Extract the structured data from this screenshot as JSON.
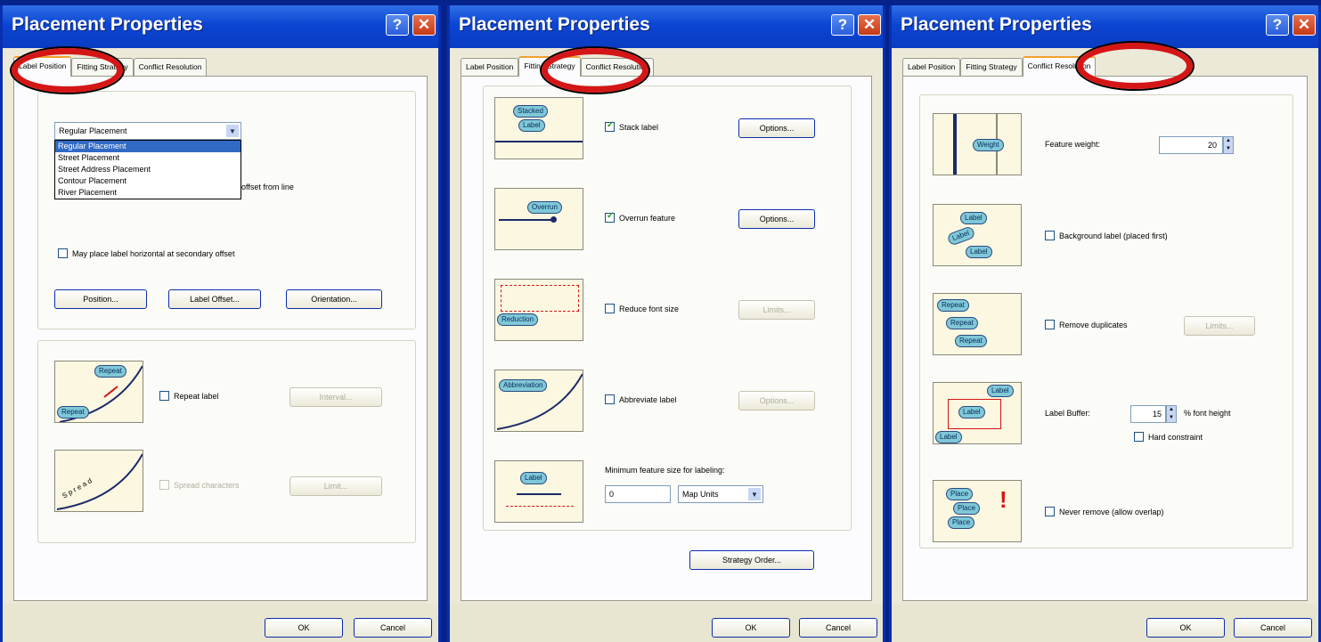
{
  "dialogs": [
    {
      "title": "Placement Properties",
      "help_glyph": "?",
      "close_glyph": "✕",
      "tabs": [
        "Label Position",
        "Fitting Strategy",
        "Conflict Resolution"
      ],
      "active_tab": 0,
      "ok_label": "OK",
      "cancel_label": "Cancel"
    },
    {
      "title": "Placement Properties",
      "help_glyph": "?",
      "close_glyph": "✕",
      "tabs": [
        "Label Position",
        "Fitting Strategy",
        "Conflict Resolution"
      ],
      "active_tab": 1,
      "ok_label": "OK",
      "cancel_label": "Cancel"
    },
    {
      "title": "Placement Properties",
      "help_glyph": "?",
      "close_glyph": "✕",
      "tabs": [
        "Label Position",
        "Fitting Strategy",
        "Conflict Resolution"
      ],
      "active_tab": 2,
      "ok_label": "OK",
      "cancel_label": "Cancel"
    }
  ],
  "label_position": {
    "placement_select": "Regular Placement",
    "placement_options": [
      "Regular Placement",
      "Street Placement",
      "Street Address Placement",
      "Contour Placement",
      "River Placement"
    ],
    "offset_text": "offset from line",
    "horizontal_secondary": "May place label horizontal at secondary offset",
    "position_btn": "Position...",
    "label_offset_btn": "Label Offset...",
    "orientation_btn": "Orientation...",
    "repeat_label": "Repeat label",
    "interval_btn": "Interval...",
    "spread_characters": "Spread characters",
    "limit_btn": "Limit...",
    "illus_repeat": "Repeat",
    "illus_spread": "S p r e a d"
  },
  "fitting_strategy": {
    "stack_label": "Stack label",
    "overrun_feature": "Overrun feature",
    "reduce_font_size": "Reduce font size",
    "abbreviate_label": "Abbreviate label",
    "options_btn": "Options...",
    "limits_btn": "Limits...",
    "min_feature_size": "Minimum feature size for labeling:",
    "min_value": "0",
    "units": "Map Units",
    "strategy_order_btn": "Strategy Order...",
    "illus_stacked": "Stacked",
    "illus_label": "Label",
    "illus_overrun": "Overrun",
    "illus_reduction": "Reduction",
    "illus_abbreviation": "Abbreviation"
  },
  "conflict_resolution": {
    "feature_weight": "Feature weight:",
    "feature_weight_value": "20",
    "background_label": "Background label (placed first)",
    "remove_duplicates": "Remove duplicates",
    "limits_btn": "Limits...",
    "label_buffer": "Label Buffer:",
    "label_buffer_value": "15",
    "font_height": "% font height",
    "hard_constraint": "Hard constraint",
    "never_remove": "Never remove (allow overlap)",
    "illus_weight": "Weight",
    "illus_label": "Label",
    "illus_repeat": "Repeat",
    "illus_place": "Place"
  },
  "colors": {
    "highlight_ring": "#d41616",
    "titlebar": "#0b45d2",
    "label_fill": "#7fc8d8"
  }
}
